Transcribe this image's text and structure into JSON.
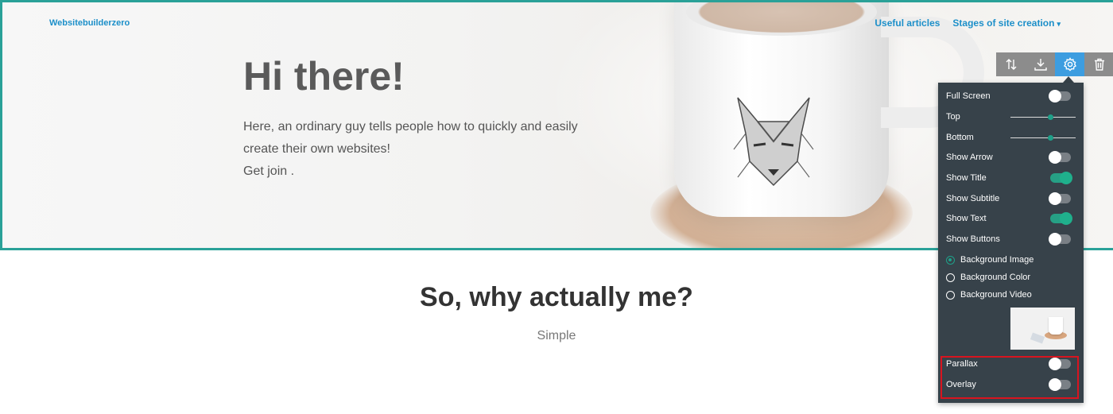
{
  "header": {
    "brand": "Websitebuilderzero",
    "nav": [
      {
        "label": "Useful articles"
      },
      {
        "label": "Stages of site creation",
        "caret": "▾"
      }
    ]
  },
  "hero": {
    "title": "Hi there!",
    "text_lines": [
      "Here, an ordinary guy tells people how to quickly and easily",
      "create their own websites!",
      "Get join ."
    ]
  },
  "section": {
    "title": "So, why actually me?",
    "subtitle": "Simple"
  },
  "toolbar": {
    "buttons": [
      {
        "icon": "sort-icon"
      },
      {
        "icon": "download-icon"
      },
      {
        "icon": "gear-icon",
        "active": true
      },
      {
        "icon": "trash-icon"
      }
    ]
  },
  "settings": {
    "full_screen": {
      "label": "Full Screen",
      "on": false
    },
    "top": {
      "label": "Top",
      "value": 0.6
    },
    "bottom": {
      "label": "Bottom",
      "value": 0.6
    },
    "show_arrow": {
      "label": "Show Arrow",
      "on": false
    },
    "show_title": {
      "label": "Show Title",
      "on": true
    },
    "show_subtitle": {
      "label": "Show Subtitle",
      "on": false
    },
    "show_text": {
      "label": "Show Text",
      "on": true
    },
    "show_buttons": {
      "label": "Show Buttons",
      "on": false
    },
    "background": {
      "options": [
        "Background Image",
        "Background Color",
        "Background Video"
      ],
      "selected": "Background Image"
    },
    "parallax": {
      "label": "Parallax",
      "on": false
    },
    "overlay": {
      "label": "Overlay",
      "on": false
    }
  },
  "colors": {
    "accent": "#1c8fc9",
    "panel_bg": "#37424a",
    "toggle_on": "#1fb08c",
    "hero_border": "#2aa198",
    "highlight": "#d9141f"
  }
}
